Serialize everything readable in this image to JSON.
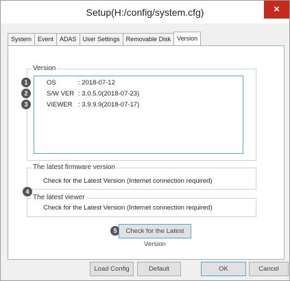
{
  "window": {
    "title": "Setup(H:/config/system.cfg)",
    "close_glyph": "×"
  },
  "tabs": [
    {
      "label": "System"
    },
    {
      "label": "Event"
    },
    {
      "label": "ADAS"
    },
    {
      "label": "User Settings"
    },
    {
      "label": "Removable Disk"
    },
    {
      "label": "Version"
    }
  ],
  "active_tab": "Version",
  "version_group": {
    "legend": "Version",
    "rows": [
      {
        "badge": "1",
        "label": "OS",
        "value": ": 2018-07-12"
      },
      {
        "badge": "2",
        "label": "S/W VER",
        "value": ": 3.0.5.0(2018-07-23)"
      },
      {
        "badge": "3",
        "label": "VIEWER",
        "value": ": 3.9.9.9(2018-07-17)"
      }
    ]
  },
  "firmware_group": {
    "legend": "The latest firmware version",
    "text": "Check for the Latest Version (Internet connection required)"
  },
  "viewer_group": {
    "badge": "4",
    "legend": "The latest viewer",
    "text": "Check for the Latest Version (Internet connection required)"
  },
  "check_button": {
    "badge": "5",
    "label": "Check for the Latest Version"
  },
  "footer": {
    "load_config": "Load Config",
    "default": "Default",
    "ok": "OK",
    "cancel": "Cancel"
  },
  "colors": {
    "close": "#c42b1c",
    "focus_border": "#4aa8e6",
    "badge": "#555555"
  }
}
